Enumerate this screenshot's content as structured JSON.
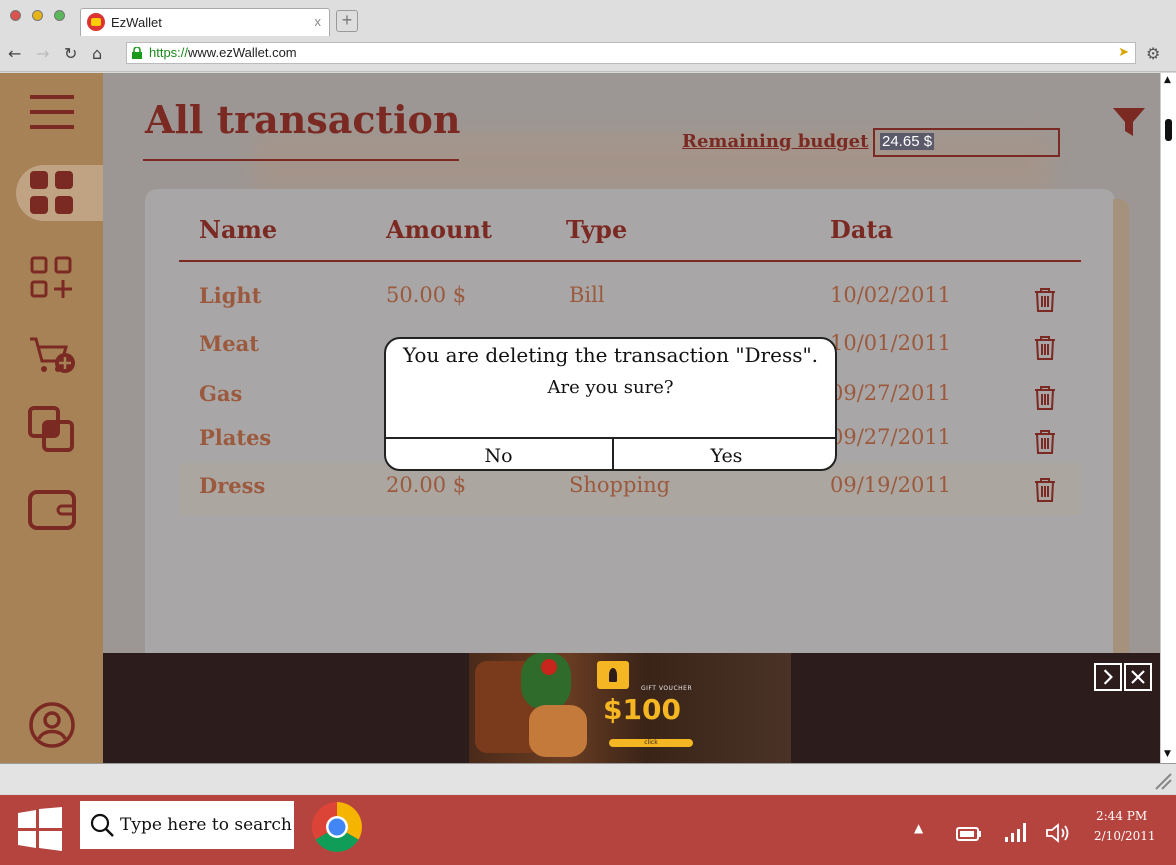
{
  "browser": {
    "tab_title": "EzWallet",
    "tab_close": "x",
    "new_tab": "+",
    "url_protocol": "https://",
    "url_rest": "www.ezWallet.com"
  },
  "page": {
    "title": "All transaction",
    "budget_label": "Remaining budget",
    "budget_value": "24.65 $"
  },
  "table": {
    "columns": [
      "Name",
      "Amount",
      "Type",
      "Data"
    ],
    "rows": [
      {
        "name": "Light",
        "amount": "50.00 $",
        "type": "Bill",
        "date": "10/02/2011"
      },
      {
        "name": "Meat",
        "amount": "",
        "type": "",
        "date": "10/01/2011"
      },
      {
        "name": "Gas",
        "amount": "",
        "type": "",
        "date": "09/27/2011"
      },
      {
        "name": "Plates",
        "amount": "",
        "type": "",
        "date": "09/27/2011"
      },
      {
        "name": "Dress",
        "amount": "20.00 $",
        "type": "Shopping",
        "date": "09/19/2011"
      }
    ]
  },
  "dialog": {
    "message": "You are deleting the transaction \"Dress\".",
    "question": "Are you sure?",
    "no_label": "No",
    "yes_label": "Yes"
  },
  "ad": {
    "voucher_label": "GIFT VOUCHER",
    "amount": "$100",
    "click_label": "click"
  },
  "taskbar": {
    "search_placeholder": "Type here to search",
    "time": "2:44 PM",
    "date": "2/10/2011"
  },
  "colors": {
    "sidebar": "#a88257",
    "accent": "#7a2a22",
    "taskbar": "#b5433e"
  }
}
